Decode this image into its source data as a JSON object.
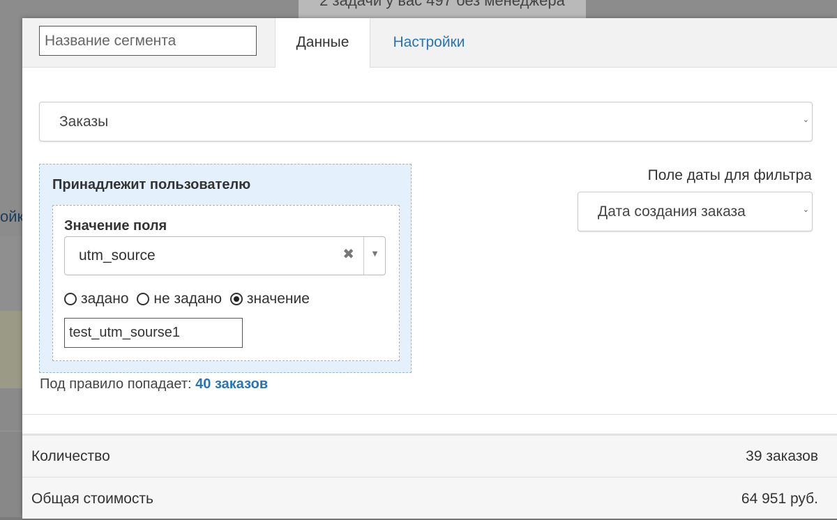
{
  "background": {
    "top_text": "2 задачи у вас 497 без менеджера",
    "left_text": "ойк"
  },
  "header": {
    "segment_name_placeholder": "Название сегмента",
    "segment_name_value": "",
    "tabs": [
      {
        "label": "Данные",
        "active": true
      },
      {
        "label": "Настройки",
        "active": false
      }
    ]
  },
  "source_select": {
    "selected": "Заказы"
  },
  "rule": {
    "title": "Принадлежит пользователю",
    "field_label": "Значение поля",
    "field_selected": "utm_source",
    "clear_icon": "✖",
    "arrow_icon": "▼",
    "radios": [
      {
        "label": "задано",
        "checked": false
      },
      {
        "label": "не задано",
        "checked": false
      },
      {
        "label": "значение",
        "checked": true
      }
    ],
    "value": "test_utm_sourse1"
  },
  "match": {
    "prefix": "Под правило попадает:",
    "link": "40 заказов"
  },
  "date_filter": {
    "label": "Поле даты для фильтра",
    "selected": "Дата создания заказа"
  },
  "summary": [
    {
      "label": "Количество",
      "value": "39 заказов"
    },
    {
      "label": "Общая стоимость",
      "value": "64 951 руб."
    }
  ],
  "colors": {
    "link": "#2b73b3",
    "rule_bg": "#e4f0fc"
  }
}
